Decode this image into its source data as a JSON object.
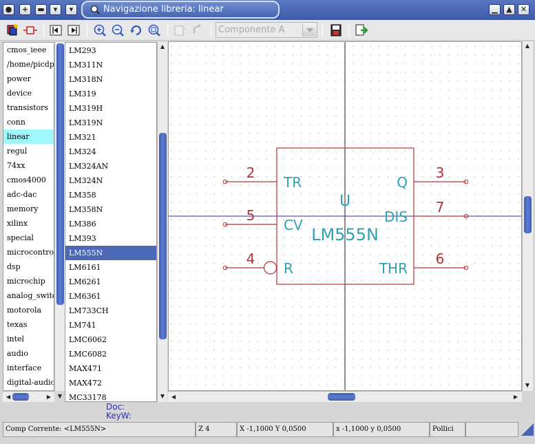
{
  "window": {
    "title": "Navigazione libreria: linear"
  },
  "titlebar_buttons": [
    "menu-icon",
    "add-icon",
    "minimize-icon",
    "shade-icon",
    "menu-arrow-icon"
  ],
  "toolbar": {
    "component_placeholder": "Componente A",
    "tools": [
      "select-library-icon",
      "select-component-icon",
      "previous-icon",
      "next-icon",
      "zoom-in-icon",
      "zoom-out-icon",
      "redraw-icon",
      "zoom-fit-icon",
      "part-a-icon",
      "part-b-icon",
      "export-icon",
      "insert-icon"
    ]
  },
  "libraries": {
    "items": [
      "cmos_ieee",
      "/home/picdp/D",
      "power",
      "device",
      "transistors",
      "conn",
      "linear",
      "regul",
      "74xx",
      "cmos4000",
      "adc-dac",
      "memory",
      "xilinx",
      "special",
      "microcontroll",
      "dsp",
      "microchip",
      "analog_switche",
      "motorola",
      "texas",
      "intel",
      "audio",
      "interface",
      "digital-audio"
    ],
    "selected": "linear"
  },
  "components": {
    "items": [
      "LM293",
      "LM311N",
      "LM318N",
      "LM319",
      "LM319H",
      "LM319N",
      "LM321",
      "LM324",
      "LM324AN",
      "LM324N",
      "LM358",
      "LM358N",
      "LM386",
      "LM393",
      "LM555N",
      "LM6161",
      "LM6261",
      "LM6361",
      "LM733CH",
      "LM741",
      "LMC6062",
      "LMC6082",
      "MAX471",
      "MAX472",
      "MC33178"
    ],
    "selected": "LM555N"
  },
  "symbol": {
    "reference": "U",
    "value": "LM555N",
    "pins_left": [
      {
        "num": "2",
        "name": "TR"
      },
      {
        "num": "5",
        "name": "CV"
      },
      {
        "num": "4",
        "name": "R"
      }
    ],
    "pins_right": [
      {
        "num": "3",
        "name": "Q"
      },
      {
        "num": "7",
        "name": "DIS"
      },
      {
        "num": "6",
        "name": "THR"
      }
    ],
    "colors": {
      "body": "#b83232",
      "text": "#30a0b4",
      "axis": "#2b2bb0",
      "grid": "#8a8a8a"
    }
  },
  "info": {
    "doc_label": "Doc:",
    "keyw_label": "KeyW:"
  },
  "status": {
    "component": "Comp Corrente: <LM555N>",
    "zoom": "Z 4",
    "abs_coords": "X -1,1000  Y 0,0500",
    "rel_coords": "x -1,1000  y 0,0500",
    "units": "Pollici"
  }
}
